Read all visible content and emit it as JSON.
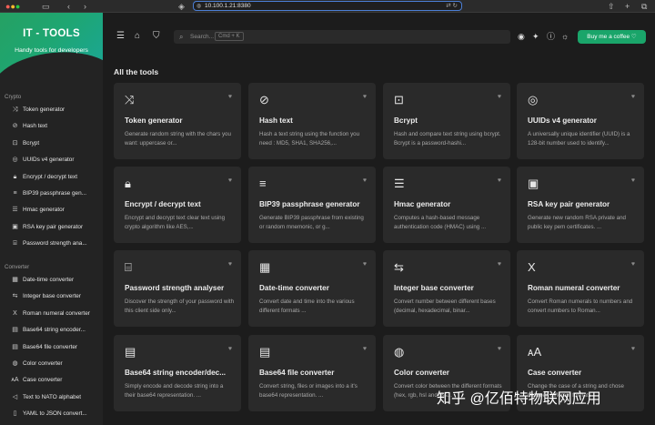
{
  "browser": {
    "url": "10.100.1.21:8380"
  },
  "brand": {
    "title": "IT - TOOLS",
    "subtitle": "Handy tools for developers"
  },
  "sidebar": {
    "sections": [
      {
        "label": "Crypto",
        "items": [
          {
            "icon": "shuffle-icon",
            "glyph": "⤨",
            "label": "Token generator"
          },
          {
            "icon": "eye-off-icon",
            "glyph": "⊘",
            "label": "Hash text"
          },
          {
            "icon": "lock-square-icon",
            "glyph": "⊡",
            "label": "Bcrypt"
          },
          {
            "icon": "fingerprint-icon",
            "glyph": "◎",
            "label": "UUIDs v4 generator"
          },
          {
            "icon": "lock-icon",
            "glyph": "🔒︎",
            "label": "Encrypt / decrypt text"
          },
          {
            "icon": "list-icon",
            "glyph": "≡",
            "label": "BIP39 passphrase gen..."
          },
          {
            "icon": "short-text-icon",
            "glyph": "☰",
            "label": "Hmac generator"
          },
          {
            "icon": "certificate-icon",
            "glyph": "▣",
            "label": "RSA key pair generator"
          },
          {
            "icon": "password-icon",
            "glyph": "⌸",
            "label": "Password strength ana..."
          }
        ]
      },
      {
        "label": "Converter",
        "items": [
          {
            "icon": "calendar-icon",
            "glyph": "▦",
            "label": "Date-time converter"
          },
          {
            "icon": "arrows-left-right-icon",
            "glyph": "⇆",
            "label": "Integer base converter"
          },
          {
            "icon": "letter-x-icon",
            "glyph": "X",
            "label": "Roman numeral converter"
          },
          {
            "icon": "file-digit-icon",
            "glyph": "▤",
            "label": "Base64 string encoder..."
          },
          {
            "icon": "file-digit-icon",
            "glyph": "▤",
            "label": "Base64 file converter"
          },
          {
            "icon": "palette-icon",
            "glyph": "◍",
            "label": "Color converter"
          },
          {
            "icon": "letter-case-icon",
            "glyph": "ᴀA",
            "label": "Case converter"
          },
          {
            "icon": "speakerphone-icon",
            "glyph": "◁",
            "label": "Text to NATO alphabet"
          },
          {
            "icon": "file-icon",
            "glyph": "▯",
            "label": "YAML to JSON convert..."
          }
        ]
      }
    ]
  },
  "topbar": {
    "search_placeholder": "Search...",
    "search_shortcut": "Cmd + K",
    "coffee_label": "Buy me a coffee"
  },
  "main": {
    "title": "All the tools",
    "cards": [
      {
        "icon": "shuffle-icon",
        "glyph": "⤨",
        "title": "Token generator",
        "desc": "Generate random string with the chars you want: uppercase or..."
      },
      {
        "icon": "eye-off-icon",
        "glyph": "⊘",
        "title": "Hash text",
        "desc": "Hash a text string using the function you need : MD5, SHA1, SHA256,..."
      },
      {
        "icon": "lock-square-icon",
        "glyph": "⊡",
        "title": "Bcrypt",
        "desc": "Hash and compare text string using bcrypt. Bcrypt is a password-hashi..."
      },
      {
        "icon": "fingerprint-icon",
        "glyph": "◎",
        "title": "UUIDs v4 generator",
        "desc": "A universally unique identifier (UUID) is a 128-bit number used to identify..."
      },
      {
        "icon": "lock-icon",
        "glyph": "🔒︎",
        "title": "Encrypt / decrypt text",
        "desc": "Encrypt and decrypt text clear text using crypto algorithm like AES,..."
      },
      {
        "icon": "list-icon",
        "glyph": "≡",
        "title": "BIP39 passphrase generator",
        "desc": "Generate BIP39 passphrase from existing or random mnemonic, or g..."
      },
      {
        "icon": "short-text-icon",
        "glyph": "☰",
        "title": "Hmac generator",
        "desc": "Computes a hash-based message authentication code (HMAC) using ..."
      },
      {
        "icon": "certificate-icon",
        "glyph": "▣",
        "title": "RSA key pair generator",
        "desc": "Generate new random RSA private and public key pem certificates. ..."
      },
      {
        "icon": "password-icon",
        "glyph": "⌸",
        "title": "Password strength analyser",
        "desc": "Discover the strength of your password with this client side only..."
      },
      {
        "icon": "calendar-icon",
        "glyph": "▦",
        "title": "Date-time converter",
        "desc": "Convert date and time into the various different formats ..."
      },
      {
        "icon": "arrows-left-right-icon",
        "glyph": "⇆",
        "title": "Integer base converter",
        "desc": "Convert number between different bases (decimal, hexadecimal, binar..."
      },
      {
        "icon": "letter-x-icon",
        "glyph": "X",
        "title": "Roman numeral converter",
        "desc": "Convert Roman numerals to numbers and convert numbers to Roman..."
      },
      {
        "icon": "file-digit-icon",
        "glyph": "▤",
        "title": "Base64 string encoder/dec...",
        "desc": "Simply encode and decode string into a their base64 representation. ..."
      },
      {
        "icon": "file-digit-icon",
        "glyph": "▤",
        "title": "Base64 file converter",
        "desc": "Convert string, files or images into a it's base64 representation. ..."
      },
      {
        "icon": "palette-icon",
        "glyph": "◍",
        "title": "Color converter",
        "desc": "Convert color between the different formats (hex, rgb, hsl and css..."
      },
      {
        "icon": "letter-case-icon",
        "glyph": "ᴀA",
        "title": "Case converter",
        "desc": "Change the case of a string and chose between different formats"
      }
    ]
  },
  "watermark": "知乎 @亿佰特物联网应用"
}
